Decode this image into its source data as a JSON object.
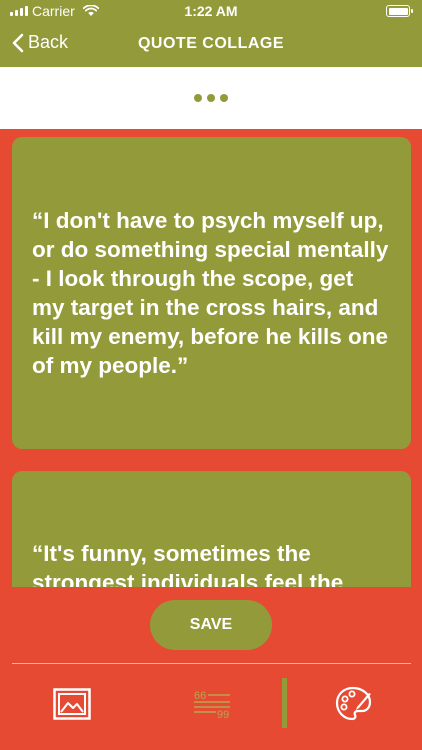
{
  "status_bar": {
    "carrier": "Carrier",
    "time": "1:22 AM",
    "battery_level": 1.0
  },
  "nav": {
    "back_label": "Back",
    "title": "QUOTE COLLAGE"
  },
  "quotes": [
    {
      "text": "“I don't have to psych myself up, or do something special mentally - I look through the scope, get my target in the cross hairs, and kill my enemy, before he kills one of my people.”"
    },
    {
      "text": "“It's funny, sometimes the strongest individuals feel the"
    }
  ],
  "actions": {
    "save_label": "SAVE"
  },
  "toolbar": {
    "items": [
      {
        "icon": "image-icon"
      },
      {
        "icon": "quote-style-icon"
      },
      {
        "icon": "palette-icon"
      }
    ]
  },
  "colors": {
    "olive": "#939A3A",
    "red_orange": "#E64A33",
    "white": "#FFFFFF"
  }
}
